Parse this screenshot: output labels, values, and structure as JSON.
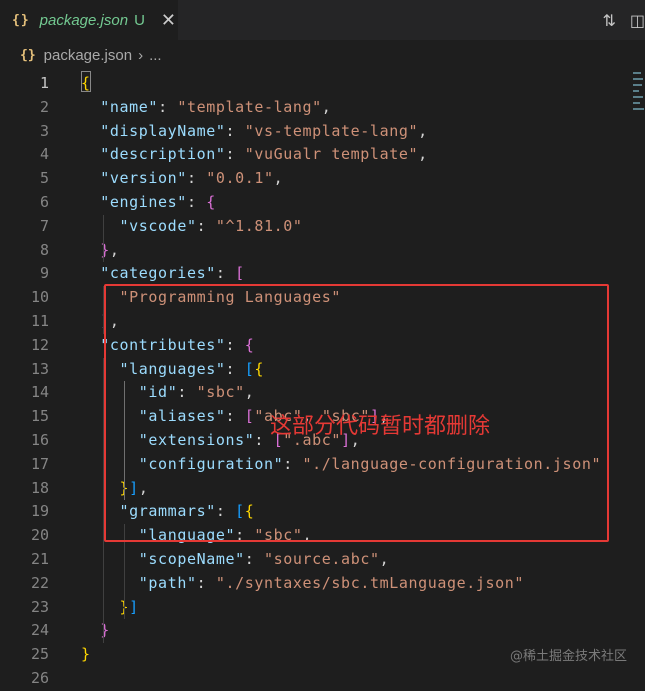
{
  "tab": {
    "icon": "{}",
    "title": "package.json",
    "status": "U",
    "close": "✕"
  },
  "actions": [
    {
      "name": "compare-changes-icon",
      "glyph": "⇅"
    },
    {
      "name": "split-editor-icon",
      "glyph": "◫"
    }
  ],
  "breadcrumb": {
    "icon": "{}",
    "file": "package.json",
    "separator": "›",
    "more": "..."
  },
  "editor": {
    "active_line": 1,
    "lines": [
      {
        "n": "1",
        "tokens": [
          [
            "b1",
            "{"
          ]
        ]
      },
      {
        "n": "2",
        "tokens": [
          [
            "p",
            "  "
          ],
          [
            "k",
            "\"name\""
          ],
          [
            "p",
            ": "
          ],
          [
            "s",
            "\"template-lang\""
          ],
          [
            "p",
            ","
          ]
        ]
      },
      {
        "n": "3",
        "tokens": [
          [
            "p",
            "  "
          ],
          [
            "k",
            "\"displayName\""
          ],
          [
            "p",
            ": "
          ],
          [
            "s",
            "\"vs-template-lang\""
          ],
          [
            "p",
            ","
          ]
        ]
      },
      {
        "n": "4",
        "tokens": [
          [
            "p",
            "  "
          ],
          [
            "k",
            "\"description\""
          ],
          [
            "p",
            ": "
          ],
          [
            "s",
            "\"vuGualr template\""
          ],
          [
            "p",
            ","
          ]
        ]
      },
      {
        "n": "5",
        "tokens": [
          [
            "p",
            "  "
          ],
          [
            "k",
            "\"version\""
          ],
          [
            "p",
            ": "
          ],
          [
            "s",
            "\"0.0.1\""
          ],
          [
            "p",
            ","
          ]
        ]
      },
      {
        "n": "6",
        "tokens": [
          [
            "p",
            "  "
          ],
          [
            "k",
            "\"engines\""
          ],
          [
            "p",
            ": "
          ],
          [
            "b2",
            "{"
          ]
        ]
      },
      {
        "n": "7",
        "tokens": [
          [
            "p",
            "    "
          ],
          [
            "k",
            "\"vscode\""
          ],
          [
            "p",
            ": "
          ],
          [
            "s",
            "\"^1.81.0\""
          ]
        ]
      },
      {
        "n": "8",
        "tokens": [
          [
            "p",
            "  "
          ],
          [
            "b2",
            "}"
          ],
          [
            "p",
            ","
          ]
        ]
      },
      {
        "n": "9",
        "tokens": [
          [
            "p",
            "  "
          ],
          [
            "k",
            "\"categories\""
          ],
          [
            "p",
            ": "
          ],
          [
            "b2",
            "["
          ]
        ]
      },
      {
        "n": "10",
        "tokens": [
          [
            "p",
            "    "
          ],
          [
            "s",
            "\"Programming Languages\""
          ]
        ]
      },
      {
        "n": "11",
        "tokens": [
          [
            "p",
            "  "
          ],
          [
            "b2",
            "]"
          ],
          [
            "p",
            ","
          ]
        ]
      },
      {
        "n": "12",
        "tokens": [
          [
            "p",
            "  "
          ],
          [
            "k",
            "\"contributes\""
          ],
          [
            "p",
            ": "
          ],
          [
            "b2",
            "{"
          ]
        ]
      },
      {
        "n": "13",
        "tokens": [
          [
            "p",
            "    "
          ],
          [
            "k",
            "\"languages\""
          ],
          [
            "p",
            ": "
          ],
          [
            "b3",
            "["
          ],
          [
            "b1",
            "{"
          ]
        ]
      },
      {
        "n": "14",
        "tokens": [
          [
            "p",
            "      "
          ],
          [
            "k",
            "\"id\""
          ],
          [
            "p",
            ": "
          ],
          [
            "s",
            "\"sbc\""
          ],
          [
            "p",
            ","
          ]
        ]
      },
      {
        "n": "15",
        "tokens": [
          [
            "p",
            "      "
          ],
          [
            "k",
            "\"aliases\""
          ],
          [
            "p",
            ": "
          ],
          [
            "b2",
            "["
          ],
          [
            "s",
            "\"abc\""
          ],
          [
            "p",
            ", "
          ],
          [
            "s",
            "\"sbc\""
          ],
          [
            "b2",
            "]"
          ],
          [
            "p",
            ","
          ]
        ]
      },
      {
        "n": "16",
        "tokens": [
          [
            "p",
            "      "
          ],
          [
            "k",
            "\"extensions\""
          ],
          [
            "p",
            ": "
          ],
          [
            "b2",
            "["
          ],
          [
            "s",
            "\".abc\""
          ],
          [
            "b2",
            "]"
          ],
          [
            "p",
            ","
          ]
        ]
      },
      {
        "n": "17",
        "tokens": [
          [
            "p",
            "      "
          ],
          [
            "k",
            "\"configuration\""
          ],
          [
            "p",
            ": "
          ],
          [
            "s",
            "\"./language-configuration.json\""
          ]
        ]
      },
      {
        "n": "18",
        "tokens": [
          [
            "p",
            "    "
          ],
          [
            "b1",
            "}"
          ],
          [
            "b3",
            "]"
          ],
          [
            "p",
            ","
          ]
        ]
      },
      {
        "n": "19",
        "tokens": [
          [
            "p",
            "    "
          ],
          [
            "k",
            "\"grammars\""
          ],
          [
            "p",
            ": "
          ],
          [
            "b3",
            "["
          ],
          [
            "b1",
            "{"
          ]
        ]
      },
      {
        "n": "20",
        "tokens": [
          [
            "p",
            "      "
          ],
          [
            "k",
            "\"language\""
          ],
          [
            "p",
            ": "
          ],
          [
            "s",
            "\"sbc\""
          ],
          [
            "p",
            ","
          ]
        ]
      },
      {
        "n": "21",
        "tokens": [
          [
            "p",
            "      "
          ],
          [
            "k",
            "\"scopeName\""
          ],
          [
            "p",
            ": "
          ],
          [
            "s",
            "\"source.abc\""
          ],
          [
            "p",
            ","
          ]
        ]
      },
      {
        "n": "22",
        "tokens": [
          [
            "p",
            "      "
          ],
          [
            "k",
            "\"path\""
          ],
          [
            "p",
            ": "
          ],
          [
            "s",
            "\"./syntaxes/sbc.tmLanguage.json\""
          ]
        ]
      },
      {
        "n": "23",
        "tokens": [
          [
            "p",
            "    "
          ],
          [
            "b1",
            "}"
          ],
          [
            "b3",
            "]"
          ]
        ]
      },
      {
        "n": "24",
        "tokens": [
          [
            "p",
            "  "
          ],
          [
            "b2",
            "}"
          ]
        ]
      },
      {
        "n": "25",
        "tokens": [
          [
            "b1",
            "}"
          ]
        ]
      },
      {
        "n": "26",
        "tokens": []
      }
    ]
  },
  "annotation": {
    "text": "这部分代码暂时都删除",
    "color": "#e53935"
  },
  "watermark": "@稀土掘金技术社区",
  "colors": {
    "background": "#1e1e1e",
    "key": "#9cdcfe",
    "string": "#ce9178",
    "bracket_gold": "#ffd700",
    "bracket_purple": "#da70d6",
    "bracket_blue": "#179fff",
    "untracked": "#73c991"
  }
}
